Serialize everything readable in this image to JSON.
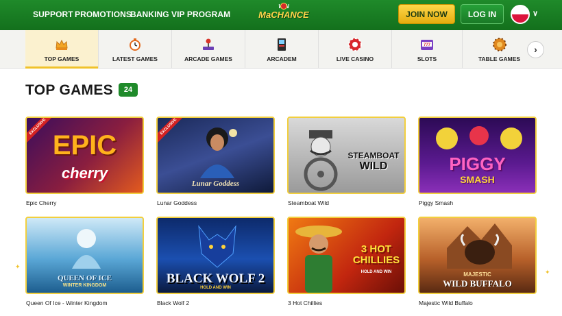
{
  "header": {
    "nav": [
      "SUPPORT",
      "PROMOTIONS",
      "BANKING",
      "VIP PROGRAM"
    ],
    "logo": {
      "top": "WIN",
      "main": "MaCHANCE"
    },
    "join_label": "JOIN NOW",
    "login_label": "LOG IN",
    "language": "Polish flag"
  },
  "categories": [
    {
      "label": "TOP GAMES",
      "icon": "crown-icon",
      "active": true
    },
    {
      "label": "LATEST GAMES",
      "icon": "stopwatch-icon",
      "active": false
    },
    {
      "label": "ARCADE GAMES",
      "icon": "joystick-icon",
      "active": false
    },
    {
      "label": "ARCADEM",
      "icon": "arcade-cabinet-icon",
      "active": false
    },
    {
      "label": "LIVE CASINO",
      "icon": "roulette-chip-icon",
      "active": false
    },
    {
      "label": "SLOTS",
      "icon": "slot-machine-icon",
      "active": false
    },
    {
      "label": "TABLE GAMES",
      "icon": "casino-chip-icon",
      "active": false
    }
  ],
  "section": {
    "title": "TOP GAMES",
    "count": "24"
  },
  "games": [
    {
      "title": "Epic Cherry",
      "art_main": "EPIC",
      "art_sub": "cherry",
      "badge": "EXCLUSIVE"
    },
    {
      "title": "Lunar Goddess",
      "art_main": "Lunar Goddess",
      "art_sub": "",
      "badge": "EXCLUSIVE"
    },
    {
      "title": "Steamboat Wild",
      "art_main": "STEAMBOAT",
      "art_sub": "WILD",
      "badge": ""
    },
    {
      "title": "Piggy Smash",
      "art_main": "PIGGY",
      "art_sub": "SMASH",
      "badge": ""
    },
    {
      "title": "Queen Of Ice - Winter Kingdom",
      "art_main": "QUEEN OF ICE",
      "art_sub": "WINTER KINGDOM",
      "badge": ""
    },
    {
      "title": "Black Wolf 2",
      "art_main": "BLACK WOLF 2",
      "art_sub": "HOLD AND WIN",
      "badge": ""
    },
    {
      "title": "3 Hot Chillies",
      "art_main": "3 HOT CHILLIES",
      "art_sub": "HOLD AND WIN",
      "badge": ""
    },
    {
      "title": "Majestic Wild Buffalo",
      "art_main": "MAJESTIC",
      "art_sub": "WILD BUFFALO",
      "badge": ""
    }
  ],
  "colors": {
    "header_green": "#1a7d24",
    "accent_gold": "#f0c22a",
    "badge_green": "#1f8a2a"
  }
}
